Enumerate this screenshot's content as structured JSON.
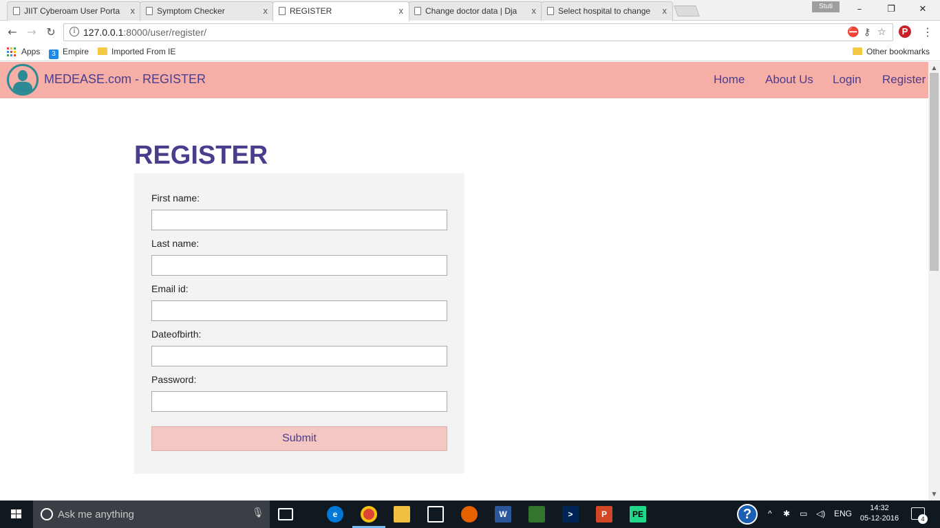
{
  "browser": {
    "tabs": [
      {
        "title": "JIIT Cyberoam User Porta",
        "close": "x"
      },
      {
        "title": "Symptom Checker",
        "close": "x"
      },
      {
        "title": "REGISTER",
        "close": "x"
      },
      {
        "title": "Change doctor data | Dja",
        "close": "x"
      },
      {
        "title": "Select hospital to change",
        "close": "x"
      }
    ],
    "profile_name": "Stuti",
    "url_host": "127.0.0.1",
    "url_path": ":8000/user/register/",
    "bookmarks": {
      "apps": "Apps",
      "empire": "Empire",
      "imported": "Imported From IE",
      "other": "Other bookmarks"
    }
  },
  "site": {
    "brand": "MEDEASE.com - REGISTER",
    "nav": [
      "Home",
      "About Us",
      "Login",
      "Register"
    ],
    "accent_color": "#4b3c8c",
    "header_color": "#f6afa7"
  },
  "form": {
    "title": "REGISTER",
    "fields": [
      {
        "label": "First name:",
        "value": ""
      },
      {
        "label": "Last name:",
        "value": ""
      },
      {
        "label": "Email id:",
        "value": ""
      },
      {
        "label": "Dateofbirth:",
        "value": ""
      },
      {
        "label": "Password:",
        "value": ""
      }
    ],
    "submit_label": "Submit"
  },
  "taskbar": {
    "search_placeholder": "Ask me anything",
    "language": "ENG",
    "time": "14:32",
    "date": "05-12-2016",
    "notification_count": "4",
    "apps": [
      "edge-icon",
      "chrome-icon",
      "file-explorer-icon",
      "store-icon",
      "firefox-icon",
      "word-icon",
      "project-icon",
      "powershell-icon",
      "powerpoint-icon",
      "pycharm-icon"
    ]
  }
}
